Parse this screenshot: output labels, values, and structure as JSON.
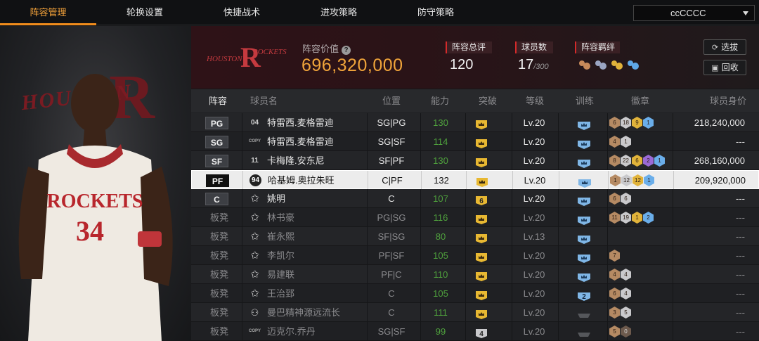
{
  "nav": {
    "tabs": [
      {
        "label": "阵容管理",
        "active": true
      },
      {
        "label": "轮换设置",
        "active": false
      },
      {
        "label": "快捷战术",
        "active": false
      },
      {
        "label": "进攻策略",
        "active": false
      },
      {
        "label": "防守策略",
        "active": false
      }
    ],
    "team_select": "ccCCCC"
  },
  "hero": {
    "bg_text": "HOUSTON",
    "bg_letter": "R"
  },
  "header": {
    "lineup_value_label": "阵容价值",
    "lineup_value": "696,320,000",
    "rating_label": "阵容总评",
    "rating_value": "120",
    "players_label": "球员数",
    "players_value": "17",
    "players_max": "/300",
    "bond_label": "阵容羁绊",
    "select_button": "选拔",
    "recycle_button": "回收",
    "accent_color": "#f0a43a"
  },
  "table": {
    "columns": [
      "阵容",
      "球员名",
      "位置",
      "能力",
      "突破",
      "等级",
      "训练",
      "徽章",
      "球员身价"
    ],
    "rows": [
      {
        "slot": "PG",
        "bench": false,
        "tag": "04",
        "name": "特雷西.麦格雷迪",
        "pos": "SG|PG",
        "ability": "130",
        "breakthrough": "crown",
        "level": "Lv.20",
        "training": "crown",
        "badges": [
          [
            "6",
            "b-bronze"
          ],
          [
            "18",
            "b-silver"
          ],
          [
            "9",
            "b-gold"
          ],
          [
            "1",
            "b-blue"
          ]
        ],
        "price": "218,240,000"
      },
      {
        "slot": "SG",
        "bench": false,
        "tag": "COPY",
        "name": "特雷西.麦格雷迪",
        "pos": "SG|SF",
        "ability": "114",
        "breakthrough": "crown",
        "level": "Lv.20",
        "training": "crown",
        "badges": [
          [
            "4",
            "b-bronze"
          ],
          [
            "1",
            "b-silver"
          ]
        ],
        "price": "---"
      },
      {
        "slot": "SF",
        "bench": false,
        "tag": "11",
        "name": "卡梅隆.安东尼",
        "pos": "SF|PF",
        "ability": "130",
        "breakthrough": "crown",
        "level": "Lv.20",
        "training": "crown",
        "badges": [
          [
            "8",
            "b-bronze"
          ],
          [
            "22",
            "b-silver"
          ],
          [
            "6",
            "b-gold"
          ],
          [
            "2",
            "b-purple"
          ],
          [
            "1",
            "b-blue"
          ]
        ],
        "price": "268,160,000"
      },
      {
        "slot": "PF",
        "bench": false,
        "selected": true,
        "tag": "94",
        "name": "哈基姆.奥拉朱旺",
        "pos": "C|PF",
        "ability": "132",
        "breakthrough": "crown",
        "level": "Lv.20",
        "training": "crown",
        "badges": [
          [
            "1",
            "b-bronze"
          ],
          [
            "12",
            "b-silver"
          ],
          [
            "12",
            "b-gold"
          ],
          [
            "1",
            "b-blue"
          ]
        ],
        "price": "209,920,000"
      },
      {
        "slot": "C",
        "bench": false,
        "tag": "star",
        "name": "姚明",
        "pos": "C",
        "ability": "107",
        "breakthrough": "6",
        "level": "Lv.20",
        "training": "crown",
        "badges": [
          [
            "6",
            "b-bronze"
          ],
          [
            "6",
            "b-silver"
          ]
        ],
        "price": "---"
      },
      {
        "slot": "板凳",
        "bench": true,
        "tag": "star",
        "name": "林书豪",
        "pos": "PG|SG",
        "ability": "116",
        "breakthrough": "crown",
        "level": "Lv.20",
        "training": "crown",
        "badges": [
          [
            "11",
            "b-bronze"
          ],
          [
            "19",
            "b-silver"
          ],
          [
            "1",
            "b-gold"
          ],
          [
            "2",
            "b-blue"
          ]
        ],
        "price": "---"
      },
      {
        "slot": "板凳",
        "bench": true,
        "tag": "star",
        "name": "崔永熙",
        "pos": "SF|SG",
        "ability": "80",
        "breakthrough": "crown",
        "level": "Lv.13",
        "training": "crown",
        "badges": [],
        "price": "---"
      },
      {
        "slot": "板凳",
        "bench": true,
        "tag": "star",
        "name": "李凯尔",
        "pos": "PF|SF",
        "ability": "105",
        "breakthrough": "crown",
        "level": "Lv.20",
        "training": "crown",
        "badges": [
          [
            "7",
            "b-bronze"
          ]
        ],
        "price": "---"
      },
      {
        "slot": "板凳",
        "bench": true,
        "tag": "star",
        "name": "易建联",
        "pos": "PF|C",
        "ability": "110",
        "breakthrough": "crown",
        "level": "Lv.20",
        "training": "crown",
        "badges": [
          [
            "4",
            "b-bronze"
          ],
          [
            "4",
            "b-silver"
          ]
        ],
        "price": "---"
      },
      {
        "slot": "板凳",
        "bench": true,
        "tag": "star",
        "name": "王治郅",
        "pos": "C",
        "ability": "105",
        "breakthrough": "crown",
        "level": "Lv.20",
        "training": "2",
        "badges": [
          [
            "6",
            "b-bronze"
          ],
          [
            "4",
            "b-silver"
          ]
        ],
        "price": "---"
      },
      {
        "slot": "板凳",
        "bench": true,
        "tag": "person",
        "name": "曼巴精神源远流长",
        "pos": "C",
        "ability": "111",
        "breakthrough": "crown",
        "level": "Lv.20",
        "training": "grey",
        "badges": [
          [
            "3",
            "b-bronze"
          ],
          [
            "5",
            "b-silver"
          ]
        ],
        "price": "---"
      },
      {
        "slot": "板凳",
        "bench": true,
        "tag": "COPY",
        "name": "迈克尔.乔丹",
        "pos": "SG|SF",
        "ability": "99",
        "breakthrough": "4",
        "level": "Lv.20",
        "training": "grey",
        "badges": [
          [
            "5",
            "b-bronze"
          ],
          [
            "0",
            "b-dark"
          ]
        ],
        "price": "---"
      }
    ]
  }
}
